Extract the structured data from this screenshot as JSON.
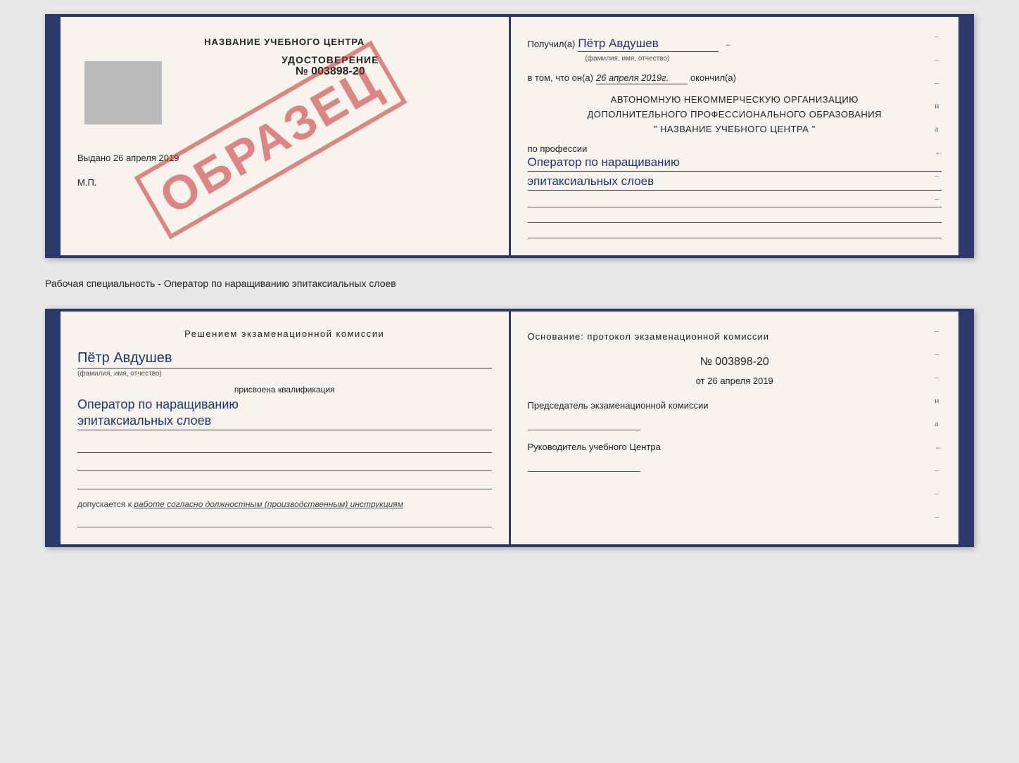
{
  "page": {
    "background_color": "#e8e8e8"
  },
  "certificate1": {
    "left": {
      "training_center_title": "НАЗВАНИЕ УЧЕБНОГО ЦЕНТРА",
      "cert_title": "УДОСТОВЕРЕНИЕ",
      "cert_number": "№ 003898-20",
      "stamp_text": "ОБРАЗЕЦ",
      "vydano_label": "Выдано",
      "vydano_date": "26 апреля 2019",
      "mp_label": "М.П."
    },
    "right": {
      "received_label": "Получил(а)",
      "received_name": "Пётр Авдушев",
      "received_sublabel": "(фамилия, имя, отчество)",
      "date_prefix": "в том, что он(а)",
      "date_value": "26 апреля 2019г.",
      "date_suffix": "окончил(а)",
      "org_line1": "АВТОНОМНУЮ НЕКОММЕРЧЕСКУЮ ОРГАНИЗАЦИЮ",
      "org_line2": "ДОПОЛНИТЕЛЬНОГО ПРОФЕССИОНАЛЬНОГО ОБРАЗОВАНИЯ",
      "org_line3": "\" НАЗВАНИЕ УЧЕБНОГО ЦЕНТРА \"",
      "profession_label": "по профессии",
      "profession_line1": "Оператор по наращиванию",
      "profession_line2": "эпитаксиальных слоев"
    }
  },
  "separator": {
    "text": "Рабочая специальность - Оператор по наращиванию эпитаксиальных слоев"
  },
  "certificate2": {
    "left": {
      "resolution_title": "Решением экзаменационной комиссии",
      "person_name": "Пётр Авдушев",
      "fio_sublabel": "(фамилия, имя, отчество)",
      "qualification_label": "присвоена квалификация",
      "qualification_line1": "Оператор по наращиванию",
      "qualification_line2": "эпитаксиальных слоев",
      "допускается_prefix": "допускается к",
      "допускается_italic": "работе согласно должностным (производственным) инструкциям"
    },
    "right": {
      "osnov_title": "Основание: протокол экзаменационной комиссии",
      "protocol_number": "№ 003898-20",
      "date_prefix": "от",
      "date_value": "26 апреля 2019",
      "chairman_label": "Председатель экзаменационной комиссии",
      "head_label": "Руководитель учебного Центра"
    }
  }
}
